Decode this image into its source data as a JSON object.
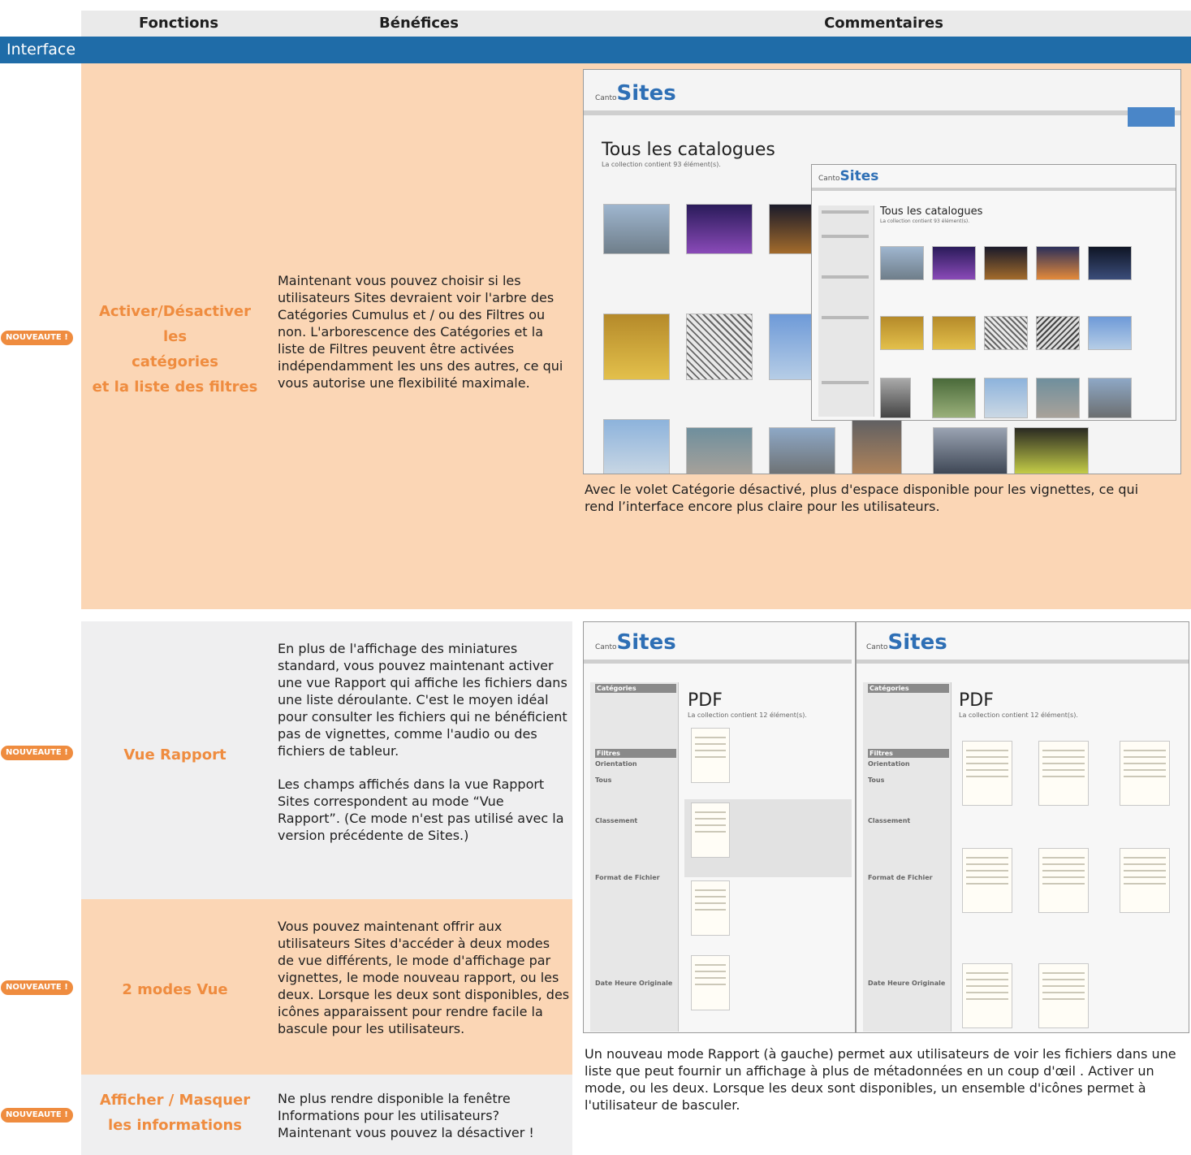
{
  "header": {
    "col_functions": "Fonctions",
    "col_benefits": "Bénéfices",
    "col_comments": "Commentaires"
  },
  "section": {
    "title": "Interface"
  },
  "rows": [
    {
      "badge": "NOUVEAUTE !",
      "function_lines": [
        "Activer/Désactiver les",
        "catégories",
        "et la liste des filtres"
      ],
      "benefit": "Maintenant vous pouvez choisir si les utilisateurs Sites devraient voir l'arbre des Catégories Cumulus et / ou des Filtres ou non. L'arborescence des Catégories et la liste de Filtres peuvent être activées indépendamment les uns des autres, ce qui vous autorise une flexibilité maximale.",
      "comment": "Avec le volet Catégorie désactivé, plus d'espace disponible pour les vignettes, ce qui rend l’interface encore plus claire pour les utilisateurs."
    },
    {
      "badge": "NOUVEAUTE !",
      "function_lines": [
        "Vue Rapport"
      ],
      "benefit_p1": "En plus de l'affichage des miniatures standard, vous pouvez maintenant activer une vue Rapport qui affiche les fichiers dans une liste déroulante. C'est le moyen idéal pour consulter les fichiers qui ne bénéficient pas de vignettes, comme l'audio ou des fichiers de tableur.",
      "benefit_p2": "Les champs affichés dans la vue Rapport Sites correspondent au mode “Vue Rapport”. (Ce mode n'est pas utilisé avec la version précédente de Sites.)"
    },
    {
      "badge": "NOUVEAUTE !",
      "function_lines": [
        "2 modes Vue"
      ],
      "benefit": "Vous pouvez maintenant offrir aux utilisateurs Sites d'accéder à deux modes de vue différents, le mode d'affichage par vignettes, le mode nouveau rapport, ou les deux. Lorsque les deux sont disponibles, des icônes apparaissent pour rendre facile la bascule pour les utilisateurs."
    },
    {
      "badge": "NOUVEAUTE !",
      "function_lines": [
        "Afficher / Masquer",
        "les informations"
      ],
      "benefit": "Ne plus rendre disponible la fenêtre Informations pour les utilisateurs? Maintenant vous pouvez la désactiver !"
    }
  ],
  "views_comment": "Un nouveau mode Rapport (à gauche) permet aux utilisateurs de voir les fichiers dans une liste que peut fournir un affichage à plus de métadonnées en un coup d'œil . Activer un mode, ou les deux. Lorsque les deux sont disponibles, un ensemble d'icônes permet à l'utilisateur de basculer.",
  "screenshots": {
    "logo_small": "Canto",
    "logo_brand": "Sites",
    "catalog_title": "Tous les catalogues",
    "catalog_subtitle": "La collection contient 93 élément(s).",
    "pdf_title": "PDF",
    "pdf_subtitle": "La collection contient 12 élément(s).",
    "side_categories": "Catégories",
    "side_filters": "Filtres",
    "side_orientation": "Orientation",
    "side_classement": "Classement",
    "side_format": "Format de Fichier",
    "side_date": "Date Heure Originale",
    "side_tous": "Tous"
  },
  "colors": {
    "section_bar": "#1f6ca8",
    "peach": "#fbd6b5",
    "grey_row": "#efeff0",
    "orange_accent": "#ef8c3f",
    "sites_blue": "#2e6fb5"
  }
}
